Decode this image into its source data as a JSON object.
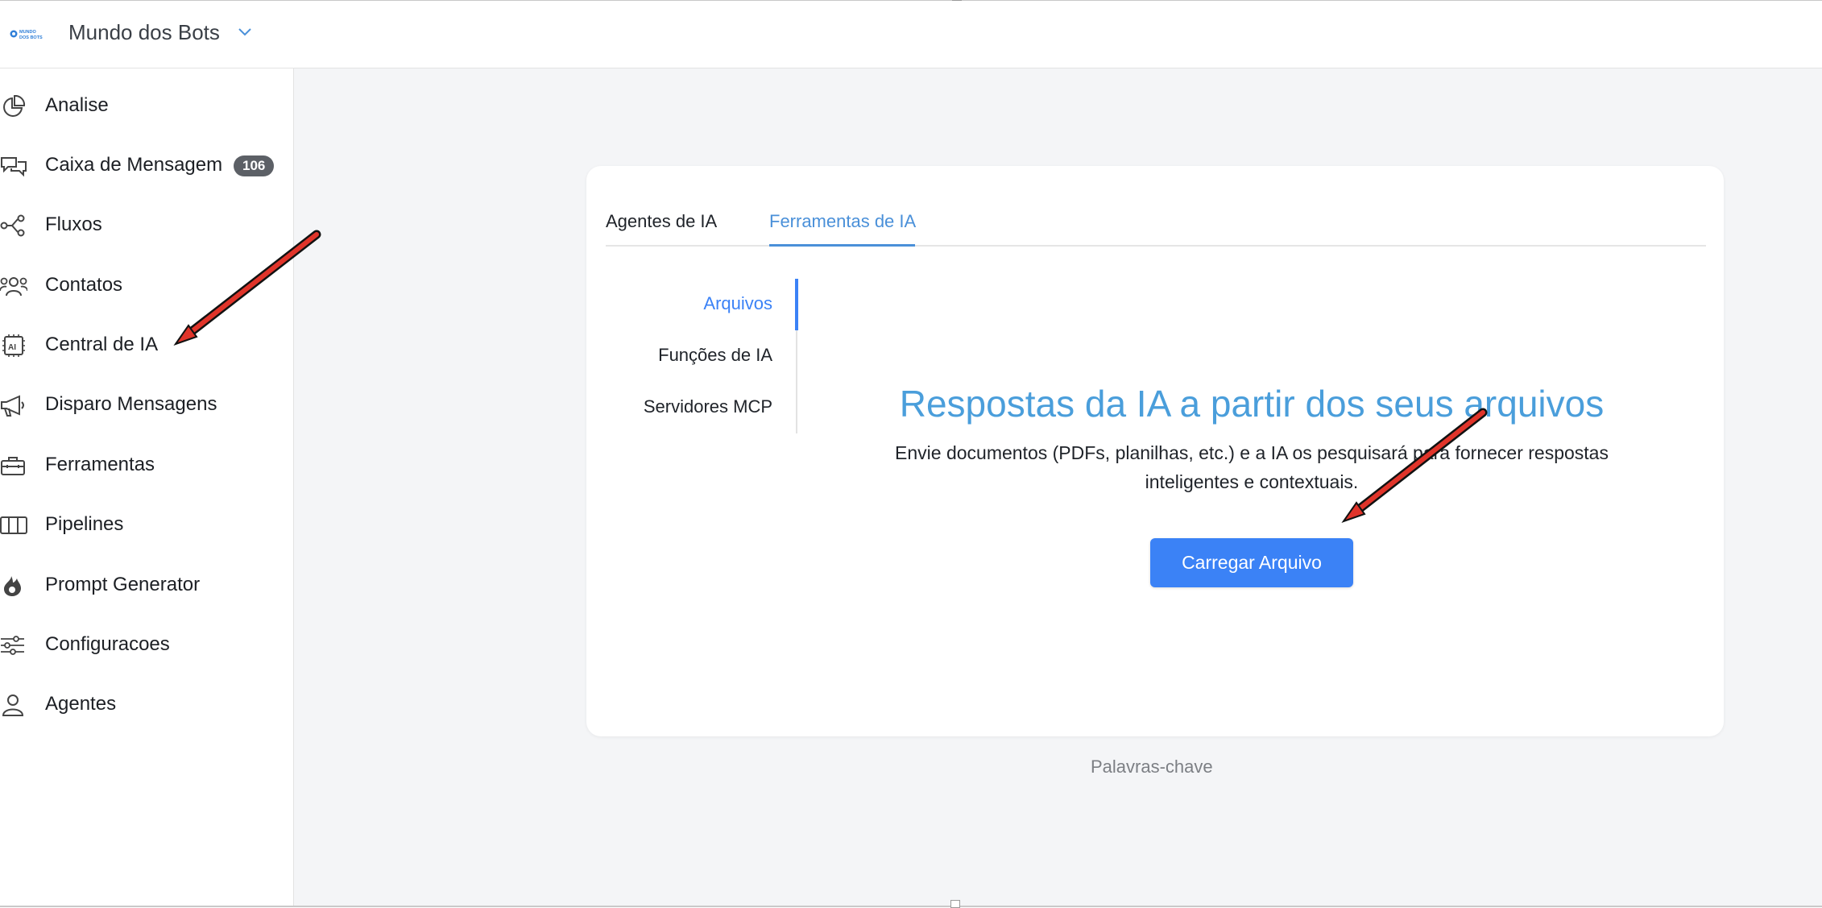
{
  "header": {
    "brand": "Mundo dos Bots",
    "logo_text": "MUNDO DOS BOTS"
  },
  "sidebar": {
    "items": [
      {
        "label": "Analise",
        "icon": "pie-chart-icon"
      },
      {
        "label": "Caixa de Mensagem",
        "icon": "chat-bubbles-icon",
        "badge": "106"
      },
      {
        "label": "Fluxos",
        "icon": "flow-nodes-icon"
      },
      {
        "label": "Contatos",
        "icon": "users-icon"
      },
      {
        "label": "Central de IA",
        "icon": "ai-chip-icon"
      },
      {
        "label": "Disparo Mensagens",
        "icon": "megaphone-icon"
      },
      {
        "label": "Ferramentas",
        "icon": "toolbox-icon"
      },
      {
        "label": "Pipelines",
        "icon": "columns-icon"
      },
      {
        "label": "Prompt Generator",
        "icon": "flame-icon"
      },
      {
        "label": "Configuracoes",
        "icon": "sliders-icon"
      },
      {
        "label": "Agentes",
        "icon": "person-icon"
      }
    ]
  },
  "tabs": {
    "items": [
      "Agentes de IA",
      "Ferramentas de IA"
    ],
    "active": "Ferramentas de IA"
  },
  "subtabs": {
    "items": [
      "Arquivos",
      "Funções de IA",
      "Servidores MCP"
    ],
    "active": "Arquivos"
  },
  "hero": {
    "title": "Respostas da IA a partir dos seus arquivos",
    "description_line1": "Envie documentos (PDFs, planilhas, etc.) e a IA os pesquisará para fornecer respostas",
    "description_line2": "inteligentes e contextuais.",
    "button": "Carregar Arquivo"
  },
  "footer": {
    "keywords": "Palavras-chave"
  },
  "colors": {
    "accent": "#3b82f6",
    "title": "#4a9edb",
    "badge": "#5c6066",
    "annotation_arrow": "#e0342a"
  }
}
